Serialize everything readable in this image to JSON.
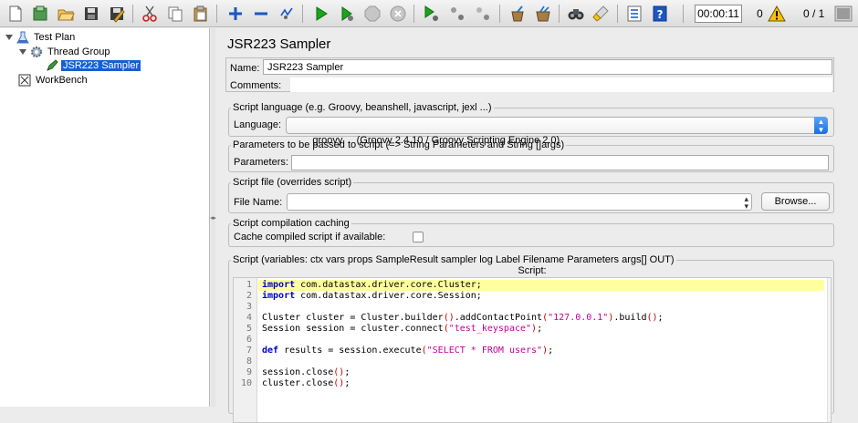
{
  "toolbar": {
    "buttons": [
      {
        "name": "new-icon"
      },
      {
        "name": "templates-icon"
      },
      {
        "name": "open-icon"
      },
      {
        "name": "save-icon"
      },
      {
        "name": "save-as-icon"
      },
      {
        "name": "cut-icon"
      },
      {
        "name": "copy-icon"
      },
      {
        "name": "paste-icon"
      },
      {
        "name": "expand-icon"
      },
      {
        "name": "collapse-icon"
      },
      {
        "name": "toggle-icon"
      },
      {
        "name": "start-icon"
      },
      {
        "name": "start-no-pause-icon"
      },
      {
        "name": "stop-icon"
      },
      {
        "name": "shutdown-icon"
      },
      {
        "name": "remote-start-icon"
      },
      {
        "name": "remote-stop-icon"
      },
      {
        "name": "remote-shutdown-icon"
      },
      {
        "name": "clear-icon"
      },
      {
        "name": "clear-all-icon"
      },
      {
        "name": "search-icon"
      },
      {
        "name": "reset-search-icon"
      },
      {
        "name": "function-helper-icon"
      },
      {
        "name": "help-icon"
      }
    ],
    "timer": "00:00:11",
    "error_count": "0",
    "thread_count": "0 / 1",
    "colors": {
      "play": "#19a51c",
      "warning": "#f5c400",
      "help": "#1c56c2",
      "selection": "#1a5ed2"
    }
  },
  "tree": {
    "items": [
      {
        "label": "Test Plan",
        "icon": "test-plan-icon"
      },
      {
        "label": "Thread Group",
        "icon": "gear-icon"
      },
      {
        "label": "JSR223 Sampler",
        "icon": "sampler-pencil-icon"
      },
      {
        "label": "WorkBench",
        "icon": "workbench-icon"
      }
    ]
  },
  "panel": {
    "title": "JSR223 Sampler",
    "name_label": "Name:",
    "name_value": "JSR223 Sampler",
    "comments_label": "Comments:",
    "language": {
      "legend": "Script language (e.g. Groovy, beanshell, javascript, jexl ...)",
      "label": "Language:",
      "selected": "groovy     (Groovy 2.4.10 / Groovy Scripting Engine 2.0)"
    },
    "parameters": {
      "legend": "Parameters to be passed to script (=> String Parameters and String []args)",
      "label": "Parameters:",
      "value": ""
    },
    "script_file": {
      "legend": "Script file (overrides script)",
      "label": "File Name:",
      "value": "",
      "browse_label": "Browse..."
    },
    "caching": {
      "legend": "Script compilation caching",
      "label": "Cache compiled script if available:"
    },
    "script": {
      "legend": "Script (variables: ctx vars props SampleResult sampler log Label Filename Parameters args[] OUT)",
      "caption": "Script:",
      "lines": [
        {
          "n": "1",
          "text": "import com.datastax.driver.core.Cluster;"
        },
        {
          "n": "2",
          "text": "import com.datastax.driver.core.Session;"
        },
        {
          "n": "3",
          "text": ""
        },
        {
          "n": "4",
          "text": "Cluster cluster = Cluster.builder().addContactPoint(\"127.0.0.1\").build();"
        },
        {
          "n": "5",
          "text": "Session session = cluster.connect(\"test_keyspace\");"
        },
        {
          "n": "6",
          "text": ""
        },
        {
          "n": "7",
          "text": "def results = session.execute(\"SELECT * FROM users\");"
        },
        {
          "n": "8",
          "text": ""
        },
        {
          "n": "9",
          "text": "session.close();"
        },
        {
          "n": "10",
          "text": "cluster.close();"
        }
      ]
    }
  }
}
